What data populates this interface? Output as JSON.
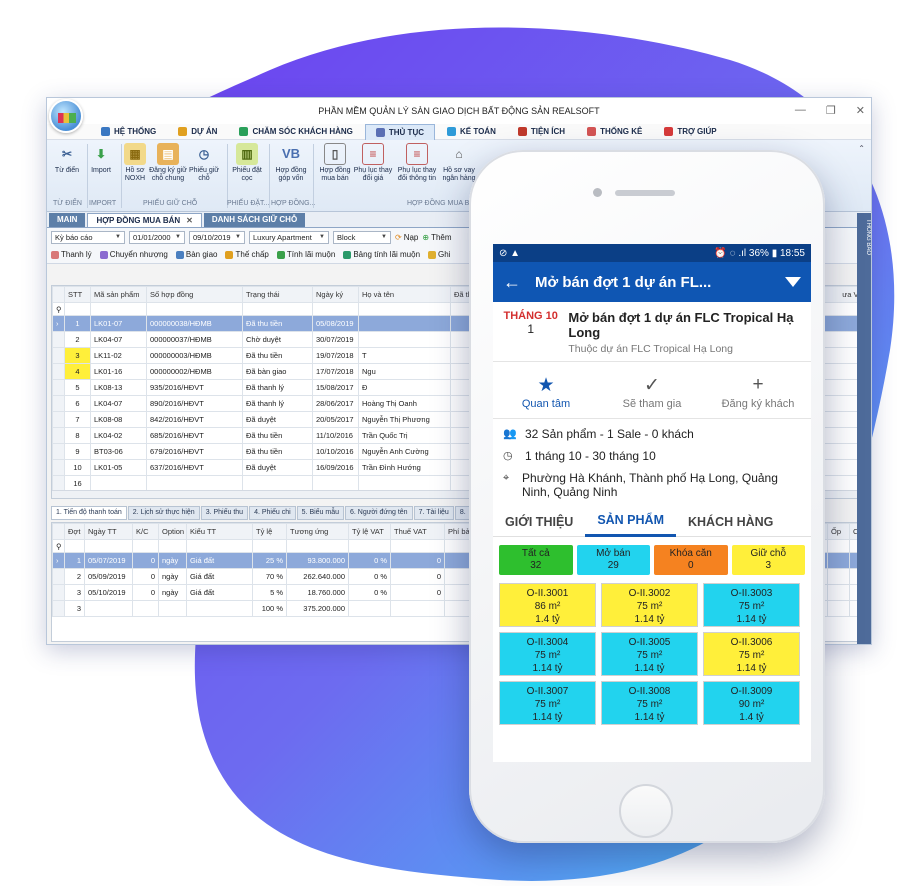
{
  "colors": {
    "accent": "#0f56b3",
    "yellow": "#ffef3a",
    "cyan": "#22d3ee",
    "green": "#2ebf2e",
    "orange": "#f58220"
  },
  "desktop": {
    "window_title": "PHẦN MỀM QUẢN LÝ SÀN GIAO DỊCH BẤT ĐỘNG SẢN REALSOFT",
    "menus": [
      {
        "label": "HỆ THỐNG",
        "icon": "grid-icon"
      },
      {
        "label": "DỰ ÁN",
        "icon": "project-icon"
      },
      {
        "label": "CHĂM SÓC KHÁCH HÀNG",
        "icon": "customer-icon"
      },
      {
        "label": "THỦ TỤC",
        "icon": "procedure-icon"
      },
      {
        "label": "KẾ TOÁN",
        "icon": "accounting-icon"
      },
      {
        "label": "TIỆN ÍCH",
        "icon": "utility-icon"
      },
      {
        "label": "THỐNG KÊ",
        "icon": "chart-icon"
      },
      {
        "label": "TRỢ GIÚP",
        "icon": "help-icon"
      }
    ],
    "ribbon": {
      "buttons": [
        {
          "label": "Từ điển",
          "glyph": "✂"
        },
        {
          "label": "Import",
          "glyph": "⬇"
        },
        {
          "label": "Hồ sơ NOXH",
          "glyph": "▦"
        },
        {
          "label": "Đăng ký giữ chỗ chung",
          "glyph": "▤"
        },
        {
          "label": "Phiếu giữ chỗ",
          "glyph": "◷"
        },
        {
          "label": "Phiếu đặt cọc",
          "glyph": "▥"
        },
        {
          "label": "Hợp đồng góp vốn",
          "glyph": "VB"
        },
        {
          "label": "Hợp đồng mua bán",
          "glyph": "▯"
        },
        {
          "label": "Phụ lục thay đổi giá",
          "glyph": "≡"
        },
        {
          "label": "Phụ lục thay đổi thông tin",
          "glyph": "≡"
        },
        {
          "label": "Hồ sơ vay ngân hàng",
          "glyph": "⌂"
        }
      ],
      "groups": [
        "TỪ ĐIỂN",
        "IMPORT",
        "PHIẾU GIỮ CHỖ",
        "PHIẾU ĐẶT...",
        "HỢP ĐỒNG...",
        "HỢP ĐỒNG MUA BÁN"
      ]
    },
    "doc_tabs": [
      "MAIN",
      "HỢP ĐỒNG MUA BÁN",
      "DANH SÁCH GIỮ CHỖ"
    ],
    "filters": {
      "period": "Kỳ báo cáo",
      "from": "01/01/2000",
      "to": "09/10/2019",
      "project": "Luxury Apartment",
      "block": "Block",
      "reload": "Nạp",
      "add": "Thêm"
    },
    "toolbar": [
      "Thanh lý",
      "Chuyển nhượng",
      "Bàn giao",
      "Thế chấp",
      "Tính lãi muộn",
      "Bảng tính lãi muộn",
      "Ghi"
    ],
    "contracts": {
      "headers": [
        "STT",
        "Mã sản phẩm",
        "Số hợp đồng",
        "Trạng thái",
        "Ngày ký",
        "Họ và tên",
        "Đã th"
      ],
      "rows": [
        [
          "1",
          "LK01-07",
          "000000038/HĐMB",
          "Đã thu tiền",
          "05/08/2019",
          ""
        ],
        [
          "2",
          "LK04-07",
          "000000037/HĐMB",
          "Chờ duyệt",
          "30/07/2019",
          ""
        ],
        [
          "3",
          "LK11-02",
          "000000003/HĐMB",
          "Đã thu tiền",
          "19/07/2018",
          "T"
        ],
        [
          "4",
          "LK01-16",
          "000000002/HĐMB",
          "Đã bàn giao",
          "17/07/2018",
          "Ngu"
        ],
        [
          "5",
          "LK08-13",
          "935/2016/HĐVT",
          "Đã thanh lý",
          "15/08/2017",
          "Đ"
        ],
        [
          "6",
          "LK04-07",
          "890/2016/HĐVT",
          "Đã thanh lý",
          "28/06/2017",
          "Hoàng Thị Oanh"
        ],
        [
          "7",
          "LK08-08",
          "842/2016/HĐVT",
          "Đã duyệt",
          "20/05/2017",
          "Nguyễn Thị Phương"
        ],
        [
          "8",
          "LK04-02",
          "685/2016/HĐVT",
          "Đã thu tiền",
          "11/10/2016",
          "Trần Quốc Trị"
        ],
        [
          "9",
          "BT03-06",
          "679/2016/HĐVT",
          "Đã thu tiền",
          "10/10/2016",
          "Nguyễn Anh Cường"
        ],
        [
          "10",
          "LK01-05",
          "637/2016/HĐVT",
          "Đã duyệt",
          "16/09/2016",
          "Trần Đình Hướng"
        ]
      ],
      "count": "16",
      "vat_header": "ưa VAT"
    },
    "bottom_tabs": [
      "1. Tiến độ thanh toán",
      "2. Lịch sử thực hiện",
      "3. Phiếu thu",
      "4. Phiếu chi",
      "5. Biểu mẫu",
      "6. Người đứng tên",
      "7. Tài liệu",
      "8."
    ],
    "payments": {
      "headers": [
        "Đợt",
        "Ngày TT",
        "K/C",
        "Option",
        "Kiểu TT",
        "Tỷ lệ",
        "Tương ứng",
        "Tỷ lệ VAT",
        "Thuế VAT",
        "Phí bả"
      ],
      "rows": [
        [
          "1",
          "05/07/2019",
          "0",
          "ngày",
          "Giá đất",
          "25 %",
          "93.800.000",
          "0 %",
          "0"
        ],
        [
          "2",
          "05/09/2019",
          "0",
          "ngày",
          "Giá đất",
          "70 %",
          "262.640.000",
          "0 %",
          "0"
        ],
        [
          "3",
          "05/10/2019",
          "0",
          "ngày",
          "Giá đất",
          "5 %",
          "18.760.000",
          "0 %",
          "0"
        ]
      ],
      "total_count": "3",
      "total_percent": "100 %",
      "total_amount": "375.200.000",
      "right_headers": [
        "Ốp",
        "Còn"
      ]
    },
    "side_panel": "THÔNG BÁO"
  },
  "phone": {
    "status_left": "⊘ ▲",
    "status_right": "⏰ ◌ .ıl 36% ▮ 18:55",
    "app_title": "Mở bán đợt 1 dự án FL...",
    "event": {
      "month": "THÁNG 10",
      "day": "1",
      "title": "Mở bán đợt 1 dự án FLC Tropical Hạ Long",
      "subtitle": "Thuộc dự án FLC Tropical Hạ Long"
    },
    "actions": [
      {
        "label": "Quan tâm",
        "icon": "star-icon",
        "glyph": "★"
      },
      {
        "label": "Sẽ tham gia",
        "icon": "check-circle-icon",
        "glyph": "✓"
      },
      {
        "label": "Đăng ký khách",
        "icon": "plus-icon",
        "glyph": "+"
      }
    ],
    "info": {
      "summary": "32 Sản phẩm - 1 Sale - 0 khách",
      "time": "1 tháng 10 - 30 tháng 10",
      "address": "Phường Hà Khánh, Thành phố Hạ Long, Quảng Ninh, Quảng Ninh"
    },
    "tabs": [
      "GIỚI THIỆU",
      "SẢN PHẨM",
      "KHÁCH HÀNG"
    ],
    "chips": [
      {
        "label": "Tất cả",
        "count": "32",
        "color": "#2ebf2e"
      },
      {
        "label": "Mở bán",
        "count": "29",
        "color": "#22d3ee"
      },
      {
        "label": "Khóa căn",
        "count": "0",
        "color": "#f58220"
      },
      {
        "label": "Giữ chỗ",
        "count": "3",
        "color": "#ffef3a"
      }
    ],
    "units": [
      {
        "code": "O-II.3001",
        "area": "86 m²",
        "price": "1.4 tỷ",
        "color": "#ffef3a"
      },
      {
        "code": "O-II.3002",
        "area": "75 m²",
        "price": "1.14 tỷ",
        "color": "#ffef3a"
      },
      {
        "code": "O-II.3003",
        "area": "75 m²",
        "price": "1.14 tỷ",
        "color": "#22d3ee"
      },
      {
        "code": "O-II.3004",
        "area": "75 m²",
        "price": "1.14 tỷ",
        "color": "#22d3ee"
      },
      {
        "code": "O-II.3005",
        "area": "75 m²",
        "price": "1.14 tỷ",
        "color": "#22d3ee"
      },
      {
        "code": "O-II.3006",
        "area": "75 m²",
        "price": "1.14 tỷ",
        "color": "#ffef3a"
      },
      {
        "code": "O-II.3007",
        "area": "75 m²",
        "price": "1.14 tỷ",
        "color": "#22d3ee"
      },
      {
        "code": "O-II.3008",
        "area": "75 m²",
        "price": "1.14 tỷ",
        "color": "#22d3ee"
      },
      {
        "code": "O-II.3009",
        "area": "90 m²",
        "price": "1.4 tỷ",
        "color": "#22d3ee"
      }
    ]
  }
}
